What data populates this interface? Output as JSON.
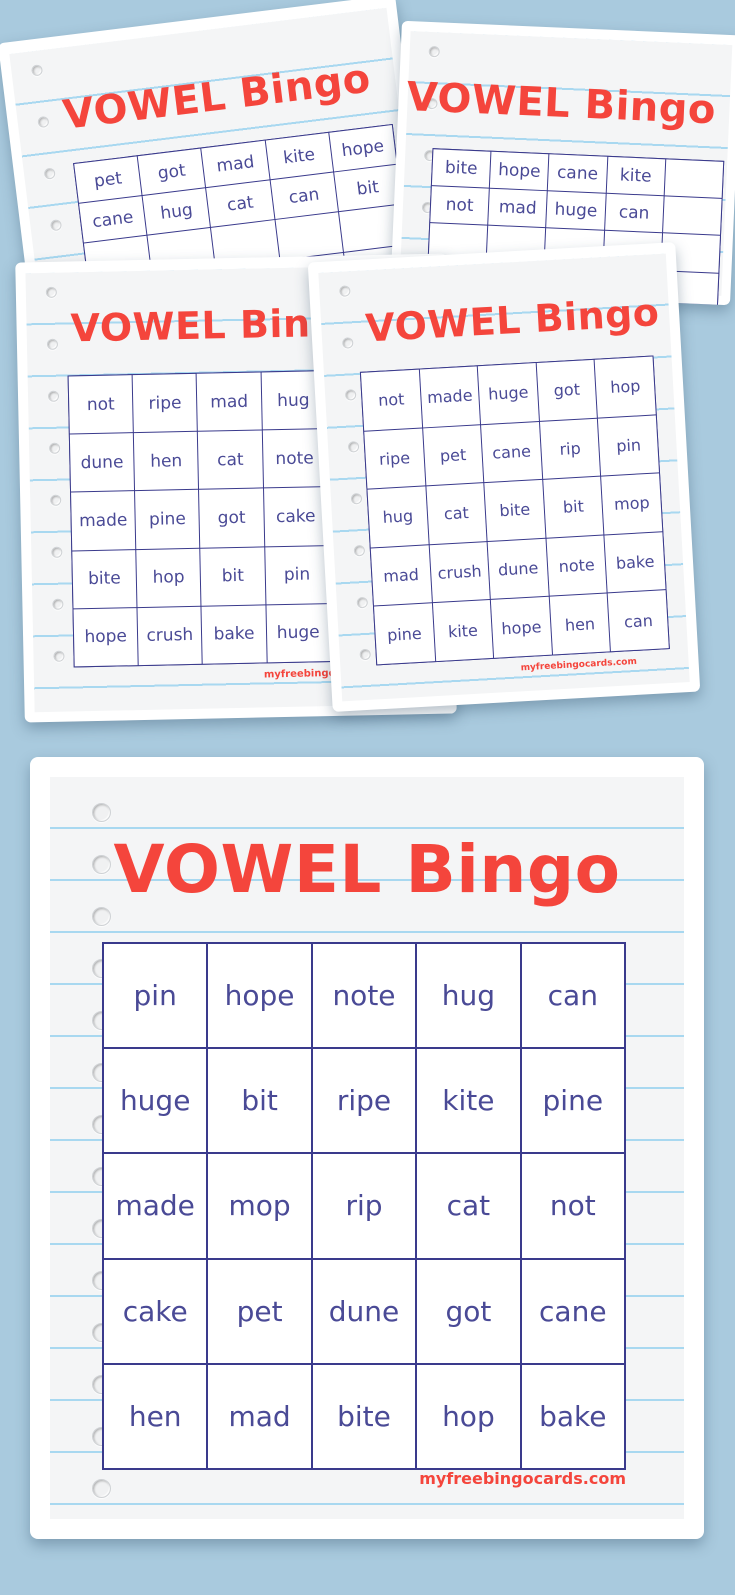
{
  "background_color": "#a9cade",
  "brand_color": "#f4453c",
  "grid_line_color": "#3a3a8c",
  "word_color": "#4a4a96",
  "rule_line_color": "#a8d8f0",
  "cards": [
    {
      "id": "card-1",
      "title": "VOWEL Bingo",
      "brand": "",
      "words": [
        "pet",
        "got",
        "mad",
        "kite",
        "hope",
        "cane",
        "hug",
        "cat",
        "can",
        "bit",
        "",
        "",
        "",
        "",
        "",
        "",
        "",
        "",
        "",
        "",
        "",
        "",
        "",
        "",
        ""
      ]
    },
    {
      "id": "card-2",
      "title": "VOWEL Bingo",
      "brand": "",
      "words": [
        "bite",
        "hope",
        "cane",
        "kite",
        "",
        "not",
        "mad",
        "huge",
        "can",
        "",
        "",
        "",
        "",
        "",
        "",
        "",
        "",
        "",
        "",
        "",
        "",
        "",
        "",
        "",
        ""
      ]
    },
    {
      "id": "card-3",
      "title": "VOWEL Bingo",
      "brand": "myfreebingocards.com",
      "words": [
        "not",
        "ripe",
        "mad",
        "hug",
        "",
        "dune",
        "hen",
        "cat",
        "note",
        "",
        "made",
        "pine",
        "got",
        "cake",
        "",
        "bite",
        "hop",
        "bit",
        "pin",
        "",
        "hope",
        "crush",
        "bake",
        "huge",
        ""
      ]
    },
    {
      "id": "card-4",
      "title": "VOWEL Bingo",
      "brand": "myfreebingocards.com",
      "words": [
        "not",
        "made",
        "huge",
        "got",
        "hop",
        "ripe",
        "pet",
        "cane",
        "rip",
        "pin",
        "hug",
        "cat",
        "bite",
        "bit",
        "mop",
        "mad",
        "crush",
        "dune",
        "note",
        "bake",
        "pine",
        "kite",
        "hope",
        "hen",
        "can"
      ]
    },
    {
      "id": "card-main",
      "title": "VOWEL Bingo",
      "brand": "myfreebingocards.com",
      "words": [
        "pin",
        "hope",
        "note",
        "hug",
        "can",
        "huge",
        "bit",
        "ripe",
        "kite",
        "pine",
        "made",
        "mop",
        "rip",
        "cat",
        "not",
        "cake",
        "pet",
        "dune",
        "got",
        "cane",
        "hen",
        "mad",
        "bite",
        "hop",
        "bake"
      ]
    }
  ]
}
